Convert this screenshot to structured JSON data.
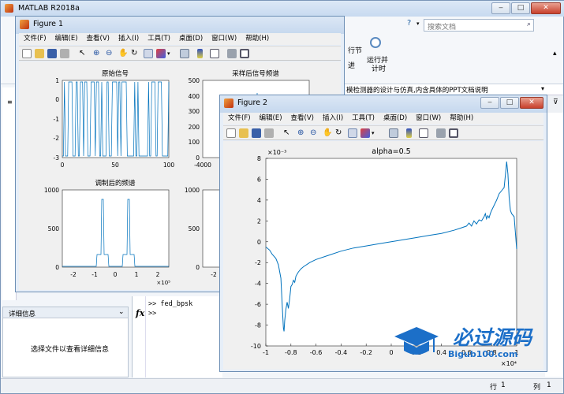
{
  "matlab": {
    "title": "MATLAB R2018a",
    "search_placeholder": "搜索文档",
    "ribbon_labels": [
      "行节",
      "进",
      "运行并",
      "计时"
    ],
    "doc_text": "模检测器的设计与仿真,内含具体的PPT文档说明",
    "cmd_lines": [
      ">> fed_bpsk",
      ">>"
    ],
    "fx_icon": "fx",
    "details_header": "详细信息",
    "details_text": "选择文件以查看详细信息",
    "status_row": "行",
    "status_row_val": "1",
    "status_col": "列",
    "status_col_val": "1",
    "watermark_title": "必过源码",
    "watermark_url": "Bigub100.com"
  },
  "figure1": {
    "title": "Figure 1",
    "menus": [
      "文件(F)",
      "编辑(E)",
      "查看(V)",
      "插入(I)",
      "工具(T)",
      "桌面(D)",
      "窗口(W)",
      "帮助(H)"
    ],
    "plots": {
      "p1": {
        "title": "原始信号",
        "yticks": [
          "1",
          "0",
          "-1",
          "-2",
          "-3"
        ],
        "xticks": [
          "0",
          "50",
          "100"
        ]
      },
      "p2": {
        "title": "采样后信号频谱",
        "yticks": [
          "500",
          "400",
          "300",
          "200",
          "100",
          "0"
        ],
        "xticks": [
          "-4000"
        ]
      },
      "p3": {
        "title": "调制后的频谱",
        "yticks": [
          "1000",
          "500",
          "0"
        ],
        "xticks": [
          "-2",
          "-1",
          "0",
          "1",
          "2"
        ],
        "xexp": "×10⁵"
      },
      "p4": {
        "yticks": [
          "1000",
          "500",
          "0"
        ],
        "xticks": [
          "-2"
        ]
      }
    }
  },
  "figure2": {
    "title": "Figure 2",
    "menus": [
      "文件(F)",
      "编辑(E)",
      "查看(V)",
      "插入(I)",
      "工具(T)",
      "桌面(D)",
      "窗口(W)",
      "帮助(H)"
    ],
    "yexp": "×10⁻³",
    "xexp": "×10⁴"
  },
  "chart_data": {
    "type": "line",
    "title": "alpha=0.5",
    "xlabel": "",
    "ylabel": "",
    "xlim": [
      -1,
      1
    ],
    "ylim": [
      -10,
      8
    ],
    "xticks": [
      -1,
      -0.8,
      -0.6,
      -0.4,
      -0.2,
      0,
      0.2,
      0.4,
      0.6,
      0.8,
      1
    ],
    "yticks": [
      8,
      6,
      4,
      2,
      0,
      -2,
      -4,
      -6,
      -8,
      -10
    ],
    "grid": false,
    "series": [
      {
        "x": [
          -1,
          -0.97,
          -0.95,
          -0.92,
          -0.9,
          -0.88,
          -0.87,
          -0.86,
          -0.855,
          -0.85,
          -0.84,
          -0.83,
          -0.82,
          -0.81,
          -0.8,
          -0.79,
          -0.78,
          -0.77,
          -0.76,
          -0.74,
          -0.72,
          -0.7,
          -0.65,
          -0.6,
          -0.5,
          -0.4,
          -0.3,
          -0.2,
          -0.1,
          0,
          0.1,
          0.2,
          0.3,
          0.4,
          0.5,
          0.55,
          0.6,
          0.62,
          0.64,
          0.66,
          0.68,
          0.7,
          0.72,
          0.74,
          0.75,
          0.76,
          0.77,
          0.78,
          0.79,
          0.8,
          0.82,
          0.84,
          0.86,
          0.88,
          0.9,
          0.91,
          0.92,
          0.93,
          0.94,
          0.95,
          0.96,
          0.98,
          1
        ],
        "y": [
          -0.5,
          -0.8,
          -1.2,
          -1.6,
          -2.2,
          -3.5,
          -6,
          -8.3,
          -8.6,
          -7.6,
          -6.5,
          -5.8,
          -6.4,
          -5.5,
          -4.3,
          -4.1,
          -3.7,
          -3.9,
          -3.3,
          -2.9,
          -2.6,
          -2.4,
          -2.0,
          -1.7,
          -1.3,
          -0.9,
          -0.6,
          -0.4,
          -0.2,
          0,
          0.2,
          0.4,
          0.6,
          0.8,
          1.1,
          1.3,
          1.5,
          1.8,
          1.5,
          2.0,
          1.7,
          2.1,
          2.0,
          2.4,
          2.7,
          2.2,
          2.5,
          2.3,
          2.7,
          3.0,
          3.5,
          4.0,
          4.6,
          4.9,
          5.2,
          6.4,
          7.7,
          6.5,
          4.2,
          3.0,
          2.7,
          2.4,
          -0.7
        ]
      }
    ]
  }
}
